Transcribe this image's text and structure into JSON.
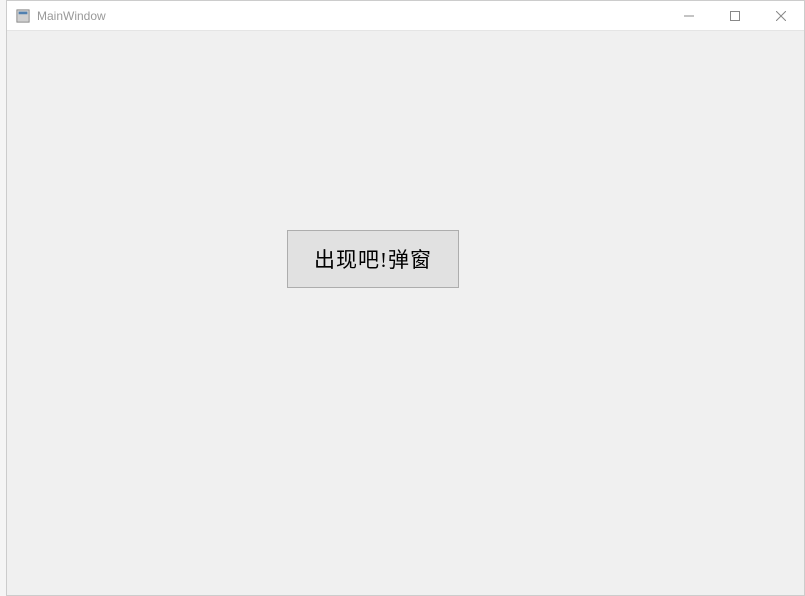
{
  "window": {
    "title": "MainWindow"
  },
  "main": {
    "button_label": "出现吧!弹窗"
  }
}
